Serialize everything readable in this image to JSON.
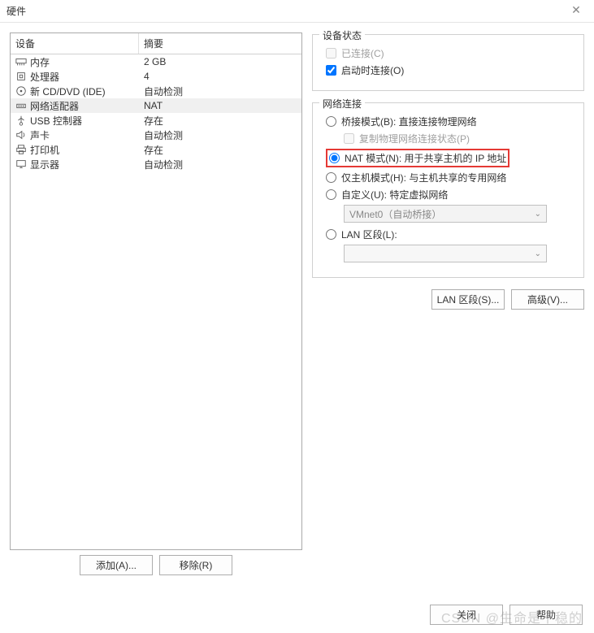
{
  "window": {
    "title": "硬件"
  },
  "deviceList": {
    "headers": {
      "device": "设备",
      "summary": "摘要"
    },
    "rows": [
      {
        "icon": "memory",
        "name": "内存",
        "summary": "2 GB",
        "selected": false
      },
      {
        "icon": "cpu",
        "name": "处理器",
        "summary": "4",
        "selected": false
      },
      {
        "icon": "disc",
        "name": "新 CD/DVD (IDE)",
        "summary": "自动检测",
        "selected": false
      },
      {
        "icon": "net",
        "name": "网络适配器",
        "summary": "NAT",
        "selected": true
      },
      {
        "icon": "usb",
        "name": "USB 控制器",
        "summary": "存在",
        "selected": false
      },
      {
        "icon": "sound",
        "name": "声卡",
        "summary": "自动检测",
        "selected": false
      },
      {
        "icon": "printer",
        "name": "打印机",
        "summary": "存在",
        "selected": false
      },
      {
        "icon": "display",
        "name": "显示器",
        "summary": "自动检测",
        "selected": false
      }
    ]
  },
  "leftButtons": {
    "add": "添加(A)...",
    "remove": "移除(R)"
  },
  "deviceStatus": {
    "legend": "设备状态",
    "connected": {
      "label": "已连接(C)",
      "checked": false,
      "disabled": true
    },
    "connectAtPower": {
      "label": "启动时连接(O)",
      "checked": true
    }
  },
  "netConn": {
    "legend": "网络连接",
    "bridged": {
      "label": "桥接模式(B): 直接连接物理网络"
    },
    "replicate": {
      "label": "复制物理网络连接状态(P)"
    },
    "nat": {
      "label": "NAT 模式(N): 用于共享主机的 IP 地址"
    },
    "hostOnly": {
      "label": "仅主机模式(H): 与主机共享的专用网络"
    },
    "custom": {
      "label": "自定义(U): 特定虚拟网络"
    },
    "customSelect": "VMnet0（自动桥接）",
    "lanSegment": {
      "label": "LAN 区段(L):"
    },
    "lanSelect": ""
  },
  "rightButtons": {
    "lanSeg": "LAN 区段(S)...",
    "advanced": "高级(V)..."
  },
  "bottom": {
    "close": "关闭",
    "help": "帮助"
  },
  "watermark": "CSDN @生命是不稳的"
}
